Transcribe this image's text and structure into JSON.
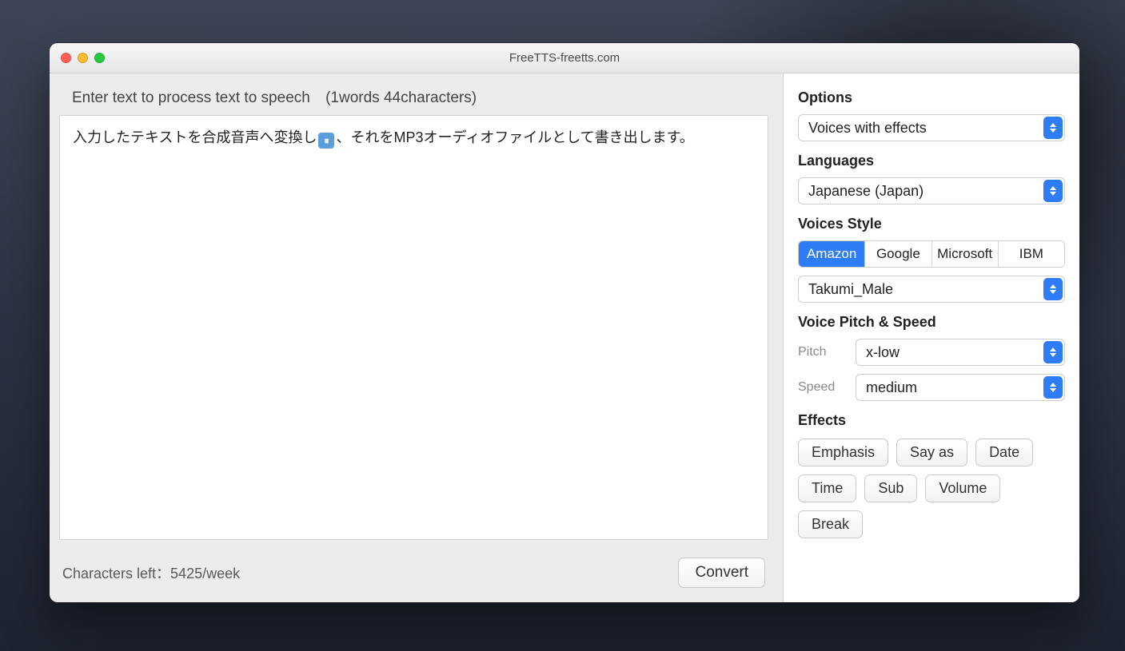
{
  "window": {
    "title": "FreeTTS-freetts.com"
  },
  "main": {
    "prompt_label": "Enter text to process text to speech",
    "counter": "(1words 44characters)",
    "text_before": "入力したテキストを合成音声へ変換し",
    "text_after": "、それをMP3オーディオファイルとして書き出します。",
    "chars_left_label": "Characters left：5425/week",
    "convert_label": "Convert"
  },
  "sidebar": {
    "options_label": "Options",
    "options_value": "Voices with effects",
    "languages_label": "Languages",
    "languages_value": "Japanese (Japan)",
    "voices_style_label": "Voices Style",
    "providers": [
      "Amazon",
      "Google",
      "Microsoft",
      "IBM"
    ],
    "provider_active_index": 0,
    "voice_value": "Takumi_Male",
    "pitch_speed_label": "Voice Pitch & Speed",
    "pitch_label": "Pitch",
    "pitch_value": "x-low",
    "speed_label": "Speed",
    "speed_value": "medium",
    "effects_label": "Effects",
    "effects": [
      "Emphasis",
      "Say as",
      "Date",
      "Time",
      "Sub",
      "Volume",
      "Break"
    ]
  }
}
